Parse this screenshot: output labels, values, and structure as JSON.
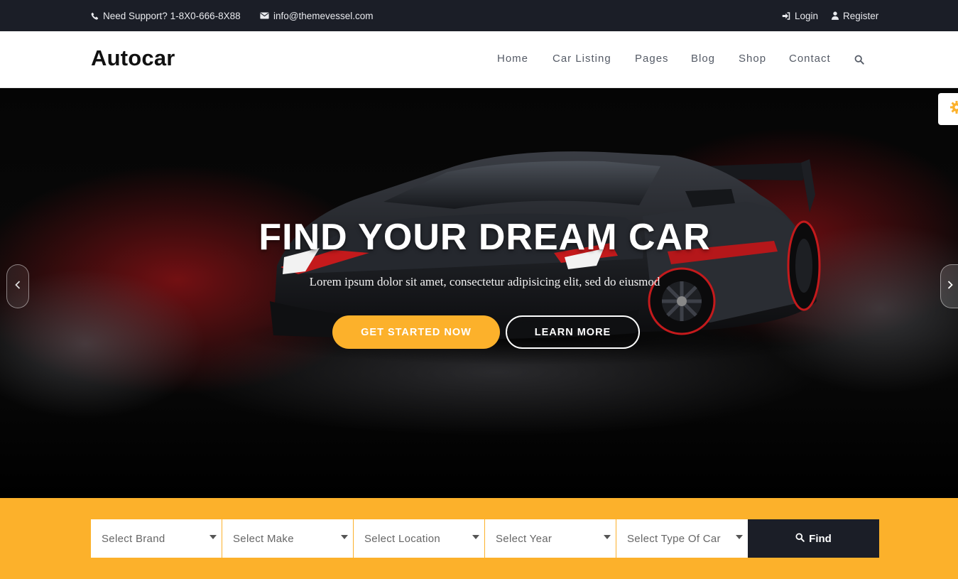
{
  "topbar": {
    "support_text": "Need Support? 1-8X0-666-8X88",
    "email_text": "info@themevessel.com",
    "login_label": "Login",
    "register_label": "Register"
  },
  "header": {
    "logo": "Autocar",
    "nav": [
      "Home",
      "Car Listing",
      "Pages",
      "Blog",
      "Shop",
      "Contact"
    ]
  },
  "hero": {
    "title": "FIND YOUR DREAM CAR",
    "subtitle": "Lorem ipsum dolor sit amet, consectetur adipisicing elit, sed do eiusmod",
    "primary_button": "GET STARTED NOW",
    "secondary_button": "LEARN MORE"
  },
  "search": {
    "selects": [
      "Select Brand",
      "Select Make",
      "Select Location",
      "Select Year",
      "Select Type Of Car"
    ],
    "find_label": "Find"
  },
  "colors": {
    "accent": "#fcb12b",
    "dark": "#1b1e27"
  },
  "icons": [
    "phone-icon",
    "envelope-icon",
    "sign-in-icon",
    "user-icon",
    "search-icon",
    "gear-icon",
    "chevron-left-icon",
    "chevron-right-icon"
  ]
}
